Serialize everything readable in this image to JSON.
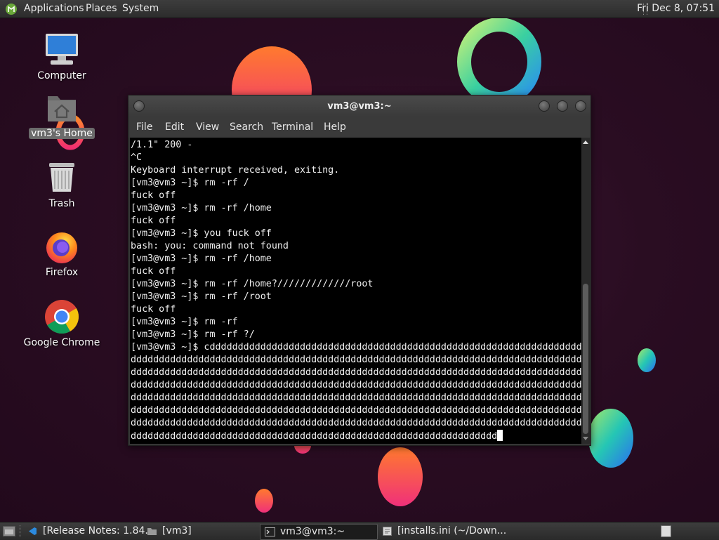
{
  "top_panel": {
    "menus": [
      "Applications",
      "Places",
      "System"
    ],
    "clock": "Fri Dec  8, 07:51"
  },
  "desktop": {
    "icons": [
      {
        "label": "Computer",
        "icon": "computer-icon"
      },
      {
        "label": "vm3's Home",
        "icon": "home-folder-icon"
      },
      {
        "label": "Trash",
        "icon": "trash-icon"
      },
      {
        "label": "Firefox",
        "icon": "firefox-icon"
      },
      {
        "label": "Google Chrome",
        "icon": "chrome-icon"
      }
    ]
  },
  "terminal": {
    "title": "vm3@vm3:~",
    "menu": [
      "File",
      "Edit",
      "View",
      "Search",
      "Terminal",
      "Help"
    ],
    "lines": [
      "/1.1\" 200 -",
      "^C",
      "Keyboard interrupt received, exiting.",
      "[vm3@vm3 ~]$ rm -rf /",
      "fuck off",
      "[vm3@vm3 ~]$ rm -rf /home",
      "fuck off",
      "[vm3@vm3 ~]$ you fuck off",
      "bash: you: command not found",
      "[vm3@vm3 ~]$ rm -rf /home",
      "fuck off",
      "[vm3@vm3 ~]$ rm -rf /home?/////////////root",
      "[vm3@vm3 ~]$ rm -rf /root",
      "fuck off",
      "[vm3@vm3 ~]$ rm -rf",
      "[vm3@vm3 ~]$ rm -rf ?/",
      "[vm3@vm3 ~]$ cddddddddddddddddddddddddddddddddddddddddddddddddddddddddddddddddddd",
      "dddddddddddddddddddddddddddddddddddddddddddddddddddddddddddddddddddddddddddddddd",
      "dddddddddddddddddddddddddddddddddddddddddddddddddddddddddddddddddddddddddddddddd",
      "dddddddddddddddddddddddddddddddddddddddddddddddddddddddddddddddddddddddddddddddd",
      "dddddddddddddddddddddddddddddddddddddddddddddddddddddddddddddddddddddddddddddddd",
      "dddddddddddddddddddddddddddddddddddddddddddddddddddddddddddddddddddddddddddddddd",
      "dddddddddddddddddddddddddddddddddddddddddddddddddddddddddddddddddddddddddddddddd",
      "ddddddddddddddddddddddddddddddddddddddddddddddddddddddddddddddddd"
    ]
  },
  "taskbar": {
    "tasks": [
      {
        "label": "[Release Notes: 1.84...",
        "icon": "vscode-icon",
        "active": false
      },
      {
        "label": "[vm3]",
        "icon": "folder-icon",
        "active": false
      },
      {
        "label": "vm3@vm3:~",
        "icon": "terminal-icon",
        "active": true
      },
      {
        "label": "[installs.ini (~/Down...",
        "icon": "text-editor-icon",
        "active": false
      }
    ]
  }
}
